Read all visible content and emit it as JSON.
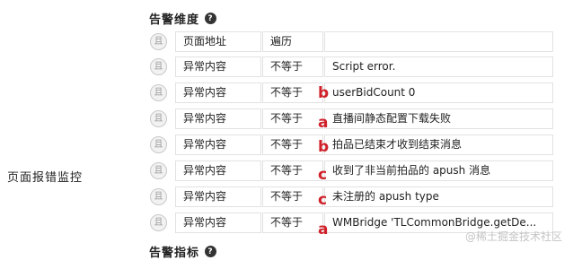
{
  "left_label": "页面报错监控",
  "dimension_title": "告警维度",
  "indicator_title": "告警指标",
  "help_glyph": "?",
  "toggle_glyph": "且",
  "rows": [
    {
      "field": "页面地址",
      "op": "遍历",
      "value": ""
    },
    {
      "field": "异常内容",
      "op": "不等于",
      "value": "Script error."
    },
    {
      "field": "异常内容",
      "op": "不等于",
      "value": "userBidCount 0"
    },
    {
      "field": "异常内容",
      "op": "不等于",
      "value": "直播间静态配置下载失败"
    },
    {
      "field": "异常内容",
      "op": "不等于",
      "value": "拍品已结束才收到结束消息"
    },
    {
      "field": "异常内容",
      "op": "不等于",
      "value": "收到了非当前拍品的 apush 消息"
    },
    {
      "field": "异常内容",
      "op": "不等于",
      "value": "未注册的 apush type"
    },
    {
      "field": "异常内容",
      "op": "不等于",
      "value": "WMBridge 'TLCommonBridge.getDe..."
    }
  ],
  "markers": [
    "b",
    "a",
    "b",
    "c",
    "c",
    "a"
  ],
  "watermark": "@稀土掘金技术社区",
  "colors": {
    "marker": "#d0202a",
    "border": "#e2e2e2"
  }
}
